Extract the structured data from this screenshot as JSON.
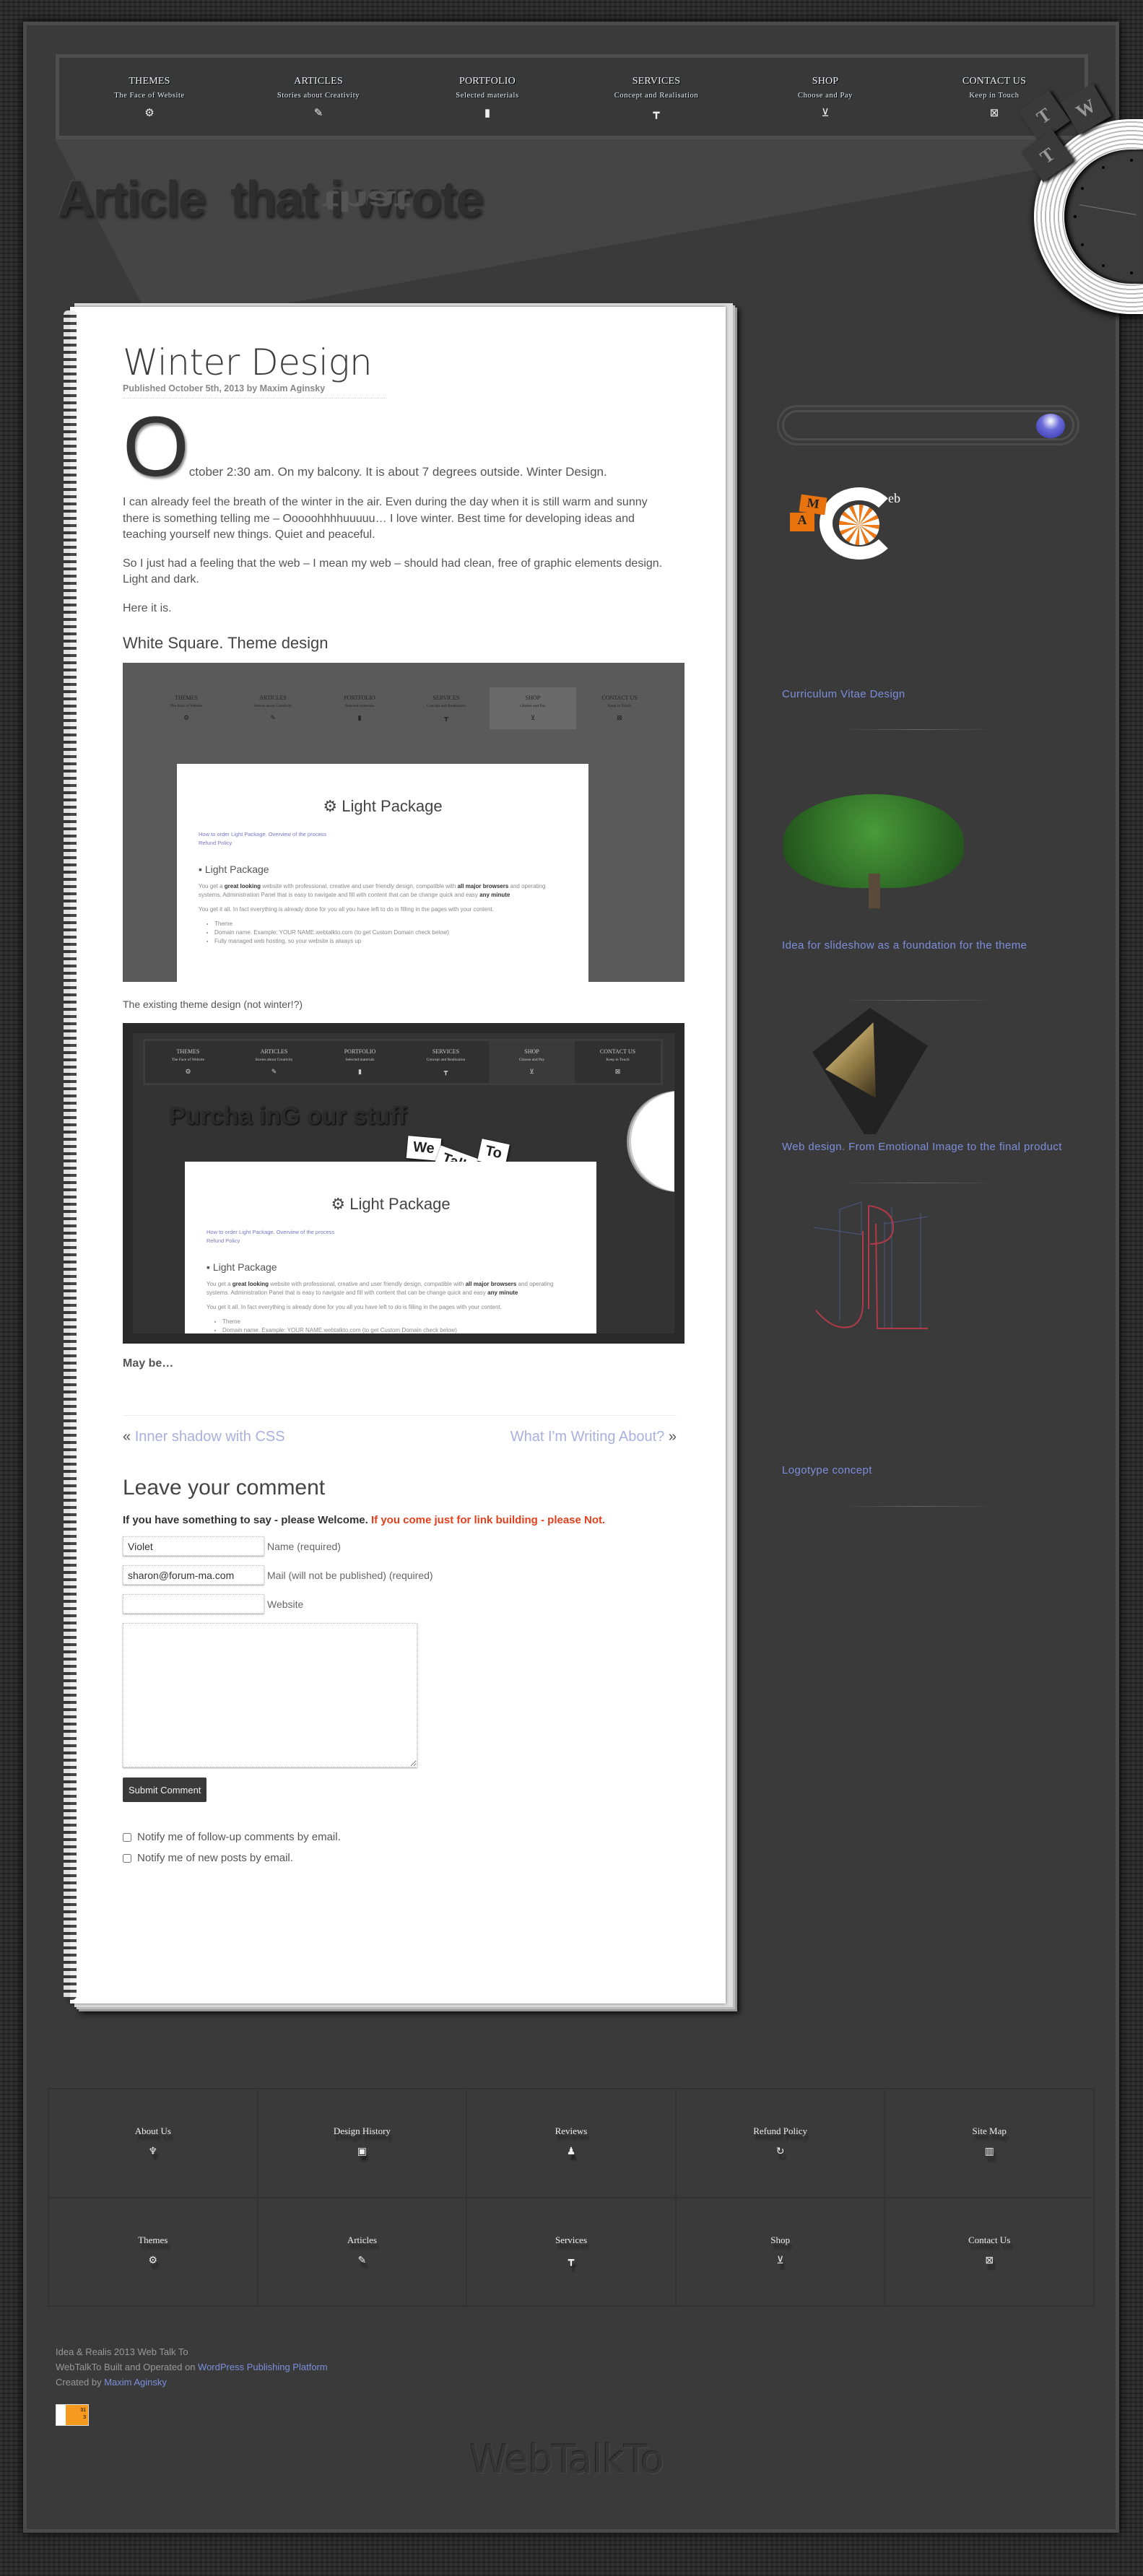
{
  "nav": {
    "items": [
      {
        "title": "THEMES",
        "subtitle": "The Face of Website",
        "icon": "gear-icon"
      },
      {
        "title": "ARTICLES",
        "subtitle": "Stories about Creativity",
        "icon": "pencil-icon"
      },
      {
        "title": "PORTFOLIO",
        "subtitle": "Selected materials",
        "icon": "book-icon"
      },
      {
        "title": "SERVICES",
        "subtitle": "Concept and Realisation",
        "icon": "paint-roller-icon"
      },
      {
        "title": "SHOP",
        "subtitle": "Choose and Pay",
        "icon": "cart-icon"
      },
      {
        "title": "CONTACT US",
        "subtitle": "Keep in Touch",
        "icon": "envelope-icon"
      }
    ]
  },
  "banner": {
    "word1": "Article",
    "word2": "that i wrote",
    "reflection_bright": "that"
  },
  "clock": {
    "tiles": [
      "W",
      "T",
      "T"
    ]
  },
  "article": {
    "title": "Winter Design",
    "meta_prefix": "Published October 5th, 2013 by ",
    "author": "Maxim Aginsky",
    "drop_cap": "O",
    "first_paragraph": "ctober 2:30 am. On my balcony. It is about 7 degrees outside. Winter Design.",
    "paragraphs": [
      "I can already feel the breath of the winter in the air. Even during the day when it is still warm and sunny there is something telling me – Ooooohhhhuuuuu… I love winter. Best time for developing ideas and teaching yourself new things. Quiet and peaceful.",
      "So I just had a feeling that the web – I mean my web – should had clean, free of graphic elements design. Light and dark.",
      "Here it is."
    ],
    "subheading": "White Square. Theme design",
    "caption2": "The existing theme design (not winter!?)",
    "closing": "May be…",
    "screenshot": {
      "panel_title": "Light Package",
      "links": [
        "How to order Light Package. Overview of the process",
        "Refund Policy"
      ],
      "section_title": "Light Package",
      "p1_a": "You get a ",
      "p1_b": "great looking",
      "p1_c": " website with professional, creative and user friendly design, compatible with ",
      "p1_d": "all major browsers",
      "p1_e": " and operating systems. Administration Panel that is easy to navigate and fill with content that can be change quick and easy ",
      "p1_f": "any minute",
      "p2": "You get it all. In fact everything is already done for you all you have left to do is filling in the pages with your content.",
      "list": [
        "Theme",
        "Domain name. Example: YOUR NAME.webtalkto.com (to get Custom Domain check below)",
        "Fully managed web hosting, so your website is always up"
      ],
      "banner2": "Purcha inG our stuff",
      "cards": [
        "We",
        "Talk",
        "To"
      ]
    }
  },
  "post_nav": {
    "prev": "Inner shadow with CSS",
    "next": "What I'm Writing About?"
  },
  "comment": {
    "heading": "Leave your comment",
    "notice": "If you have something to say - please Welcome.",
    "notice_warning": "If you come just for link building - please Not.",
    "name_value": "Violet",
    "name_label": "Name (required)",
    "mail_value": "sharon@forum-ma.com",
    "mail_label": "Mail (will not be published) (required)",
    "website_value": "",
    "website_label": "Website",
    "comment_value": "",
    "submit": "Submit Comment",
    "notify_comments": "Notify me of follow-up comments by email.",
    "notify_posts": "Notify me of new posts by email."
  },
  "sidebar": {
    "search_value": "",
    "items": [
      {
        "caption": "Curriculum Vitae Design",
        "image": "AMA web logo"
      },
      {
        "caption": "Idea for slideshow as a foundation for the theme",
        "image": "tree"
      },
      {
        "caption": "Web design. From Emotional Image to the final product",
        "image": "gold arrow emblem"
      },
      {
        "caption": "Logotype concept",
        "image": "UP logotype sketch"
      }
    ],
    "logo_letters": [
      "M",
      "A",
      "eb"
    ]
  },
  "footer": {
    "grid": [
      {
        "label": "About Us",
        "icon": "person-icon"
      },
      {
        "label": "Design History",
        "icon": "camera-icon"
      },
      {
        "label": "Reviews",
        "icon": "reviews-icon"
      },
      {
        "label": "Refund Policy",
        "icon": "refund-icon"
      },
      {
        "label": "Site Map",
        "icon": "map-icon"
      },
      {
        "label": "Themes",
        "icon": "gear-icon"
      },
      {
        "label": "Articles",
        "icon": "pencil-icon"
      },
      {
        "label": "Services",
        "icon": "paint-roller-icon"
      },
      {
        "label": "Shop",
        "icon": "cart-icon"
      },
      {
        "label": "Contact Us",
        "icon": "envelope-icon"
      }
    ],
    "line1": "Idea & Realis 2013 Web Talk To",
    "line2_prefix": "WebTalkTo Built and Operated on ",
    "line2_link": "WordPress Publishing Platform",
    "line3_prefix": "Created by ",
    "line3_link": "Maxim Aginsky",
    "badge": [
      "31",
      "3"
    ],
    "wordmark": "WebTalkTo"
  },
  "colors": {
    "link": "#7d8fdc",
    "warning": "#e2401c",
    "background": "#3a3a3a"
  }
}
